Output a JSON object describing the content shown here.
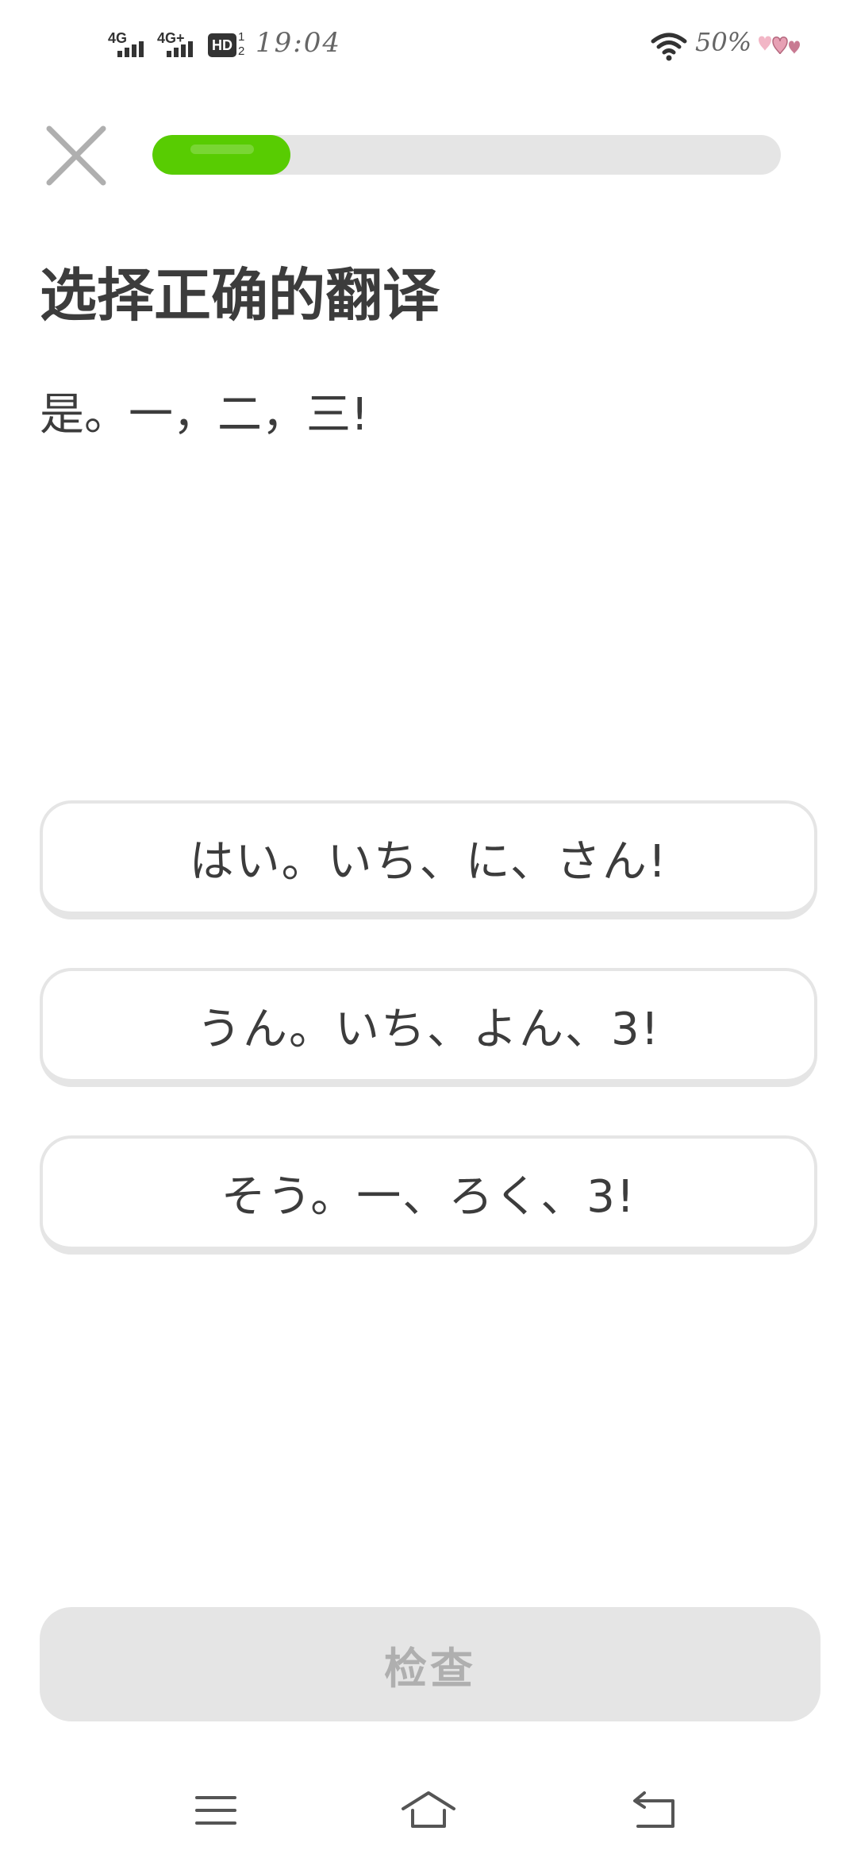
{
  "status_bar": {
    "network_1": "4G",
    "network_2": "4G+",
    "hd_badge": "HD",
    "hd_sub": "1\n2",
    "time": "19:04",
    "battery": "50%",
    "icons": [
      "signal-icon",
      "signal-icon",
      "hd-icon",
      "wifi-icon",
      "hearts-icon"
    ]
  },
  "header": {
    "close_icon": "close-icon",
    "progress": 0.22,
    "colors": {
      "progress_fill": "#58cc02",
      "progress_track": "#e5e5e5"
    }
  },
  "question": {
    "title": "选择正确的翻译",
    "prompt": "是。一，二，三!"
  },
  "options": [
    {
      "label": "はい。いち、に、さん!"
    },
    {
      "label": "うん。いち、よん、3!"
    },
    {
      "label": "そう。一、ろく、3!"
    }
  ],
  "check_button": {
    "label": "检查",
    "enabled": false
  },
  "nav_bar": {
    "icons": [
      "menu-icon",
      "home-icon",
      "back-icon"
    ]
  }
}
